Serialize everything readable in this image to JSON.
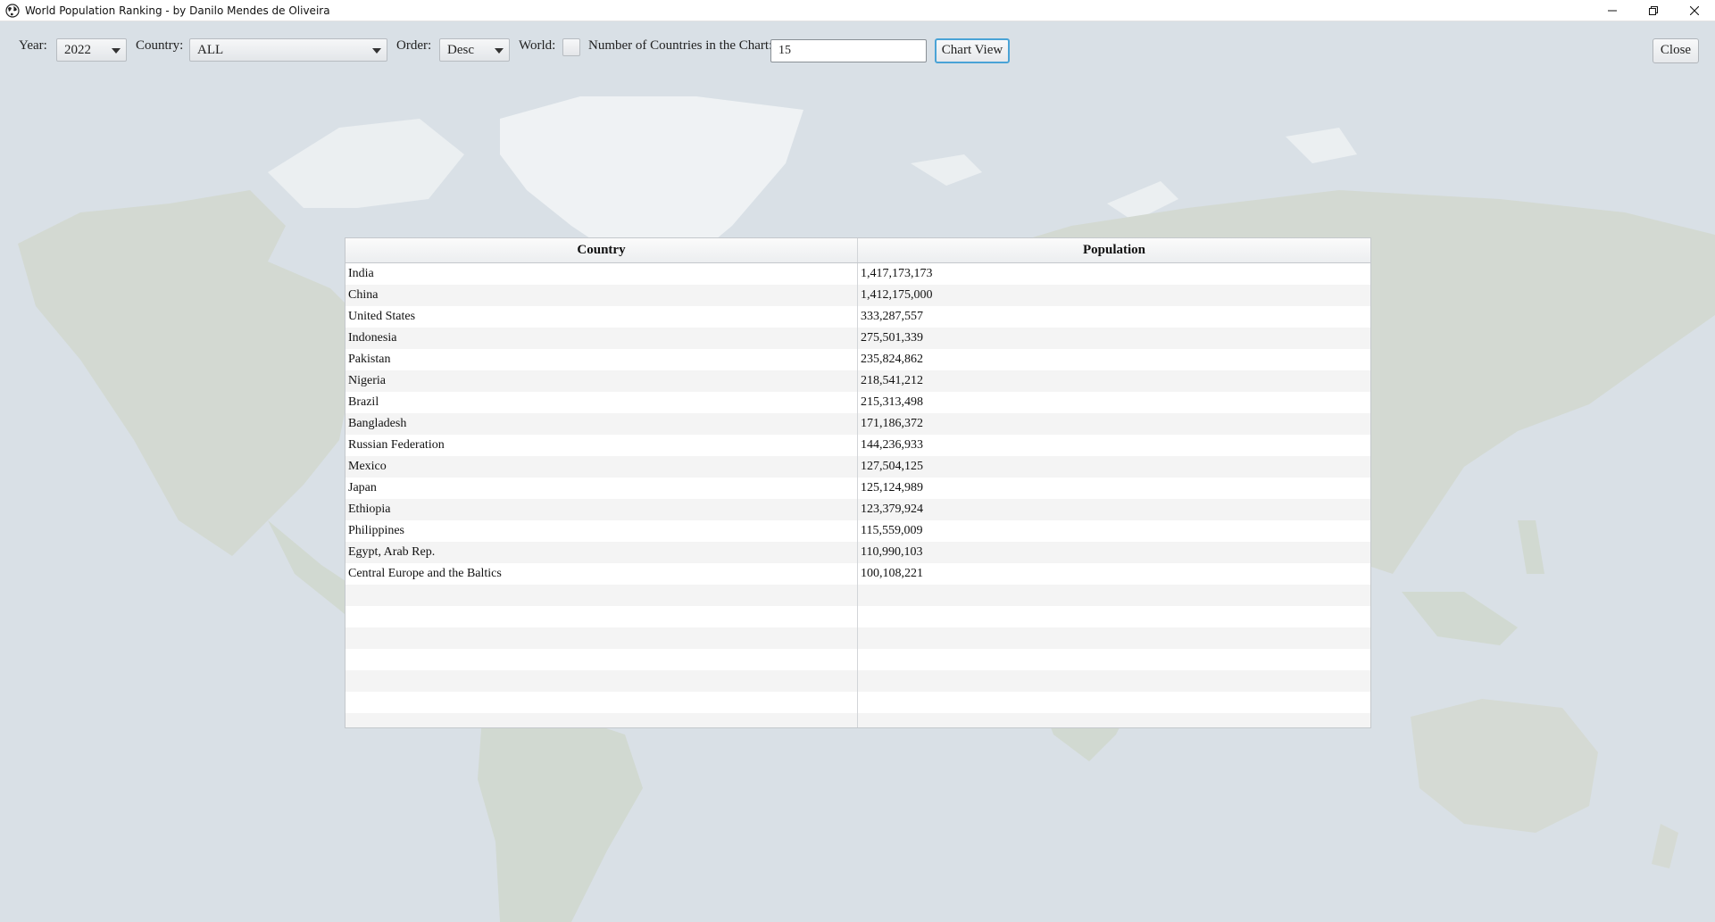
{
  "window": {
    "title": "World Population Ranking - by Danilo Mendes de Oliveira"
  },
  "toolbar": {
    "year_label": "Year:",
    "year_value": "2022",
    "country_label": "Country:",
    "country_value": "ALL",
    "order_label": "Order:",
    "order_value": "Desc",
    "world_label": "World:",
    "world_checked": false,
    "count_label": "Number of Countries in the Chart:",
    "count_value": "15",
    "chart_view_label": "Chart View",
    "close_label": "Close"
  },
  "table": {
    "headers": [
      "Country",
      "Population"
    ],
    "rows": [
      [
        "India",
        "1,417,173,173"
      ],
      [
        "China",
        "1,412,175,000"
      ],
      [
        "United States",
        "333,287,557"
      ],
      [
        "Indonesia",
        "275,501,339"
      ],
      [
        "Pakistan",
        "235,824,862"
      ],
      [
        "Nigeria",
        "218,541,212"
      ],
      [
        "Brazil",
        "215,313,498"
      ],
      [
        "Bangladesh",
        "171,186,372"
      ],
      [
        "Russian Federation",
        "144,236,933"
      ],
      [
        "Mexico",
        "127,504,125"
      ],
      [
        "Japan",
        "125,124,989"
      ],
      [
        "Ethiopia",
        "123,379,924"
      ],
      [
        "Philippines",
        "115,559,009"
      ],
      [
        "Egypt, Arab Rep.",
        "110,990,103"
      ],
      [
        "Central Europe and the Baltics",
        "100,108,221"
      ]
    ]
  },
  "colors": {
    "map_water": "#d3dbe2",
    "map_land": "#c9d0c4",
    "map_ice": "#f4f6f8",
    "accent_focus": "#4aa3d6"
  }
}
